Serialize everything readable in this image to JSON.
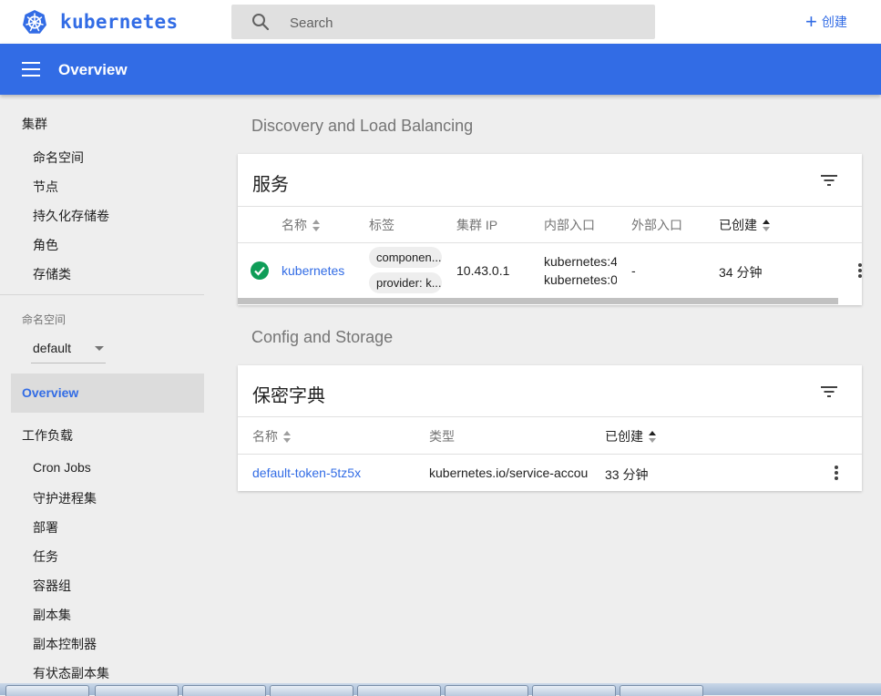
{
  "app": {
    "logo_text": "kubernetes",
    "search_placeholder": "Search",
    "create_label": "创建",
    "page_title": "Overview"
  },
  "colors": {
    "brand": "#326ce5",
    "success": "#0f9d58"
  },
  "sidebar": {
    "cluster_header": "集群",
    "cluster_items": [
      "命名空间",
      "节点",
      "持久化存储卷",
      "角色",
      "存储类"
    ],
    "namespace_label": "命名空间",
    "namespace_value": "default",
    "active_item": "Overview",
    "workloads_header": "工作负载",
    "workload_items": [
      "Cron Jobs",
      "守护进程集",
      "部署",
      "任务",
      "容器组",
      "副本集",
      "副本控制器",
      "有状态副本集"
    ]
  },
  "discovery": {
    "section_title": "Discovery and Load Balancing",
    "card_title": "服务",
    "columns": [
      "名称",
      "标签",
      "集群 IP",
      "内部入口",
      "外部入口",
      "已创建"
    ],
    "rows": [
      {
        "status_icon": "check-circle-icon",
        "name": "kubernetes",
        "labels": [
          "componen...",
          "provider: k..."
        ],
        "cluster_ip": "10.43.0.1",
        "internal_endpoints": [
          "kubernetes:4",
          "kubernetes:0"
        ],
        "external_endpoints": "-",
        "created": "34 分钟"
      }
    ]
  },
  "config": {
    "section_title": "Config and Storage",
    "card_title": "保密字典",
    "columns": [
      "名称",
      "类型",
      "已创建"
    ],
    "rows": [
      {
        "name": "default-token-5tz5x",
        "type": "kubernetes.io/service-accou",
        "created": "33 分钟"
      }
    ]
  }
}
